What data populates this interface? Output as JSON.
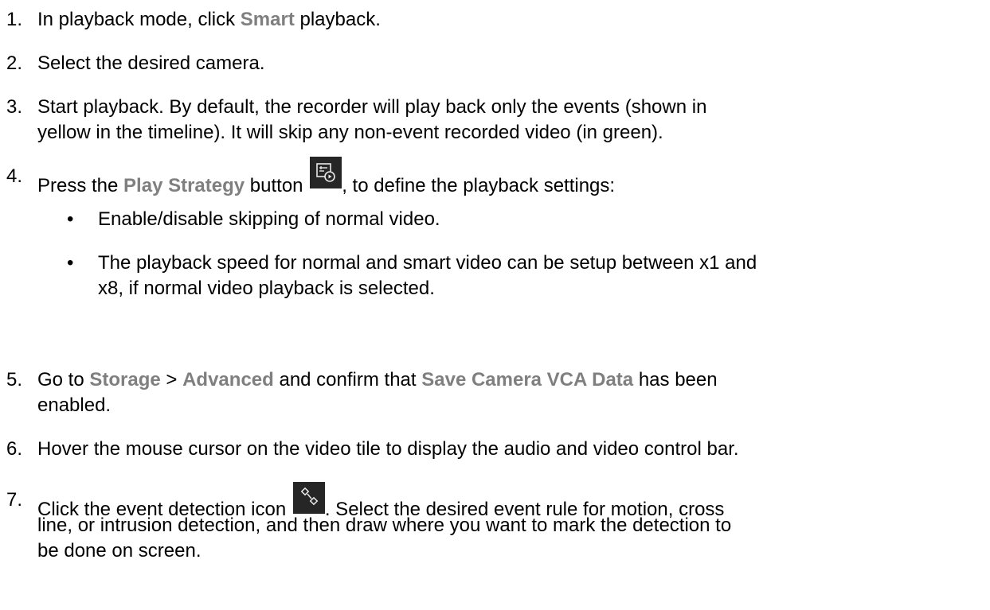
{
  "steps": [
    {
      "num": "1.",
      "pre": "In playback mode, click ",
      "hl": "Smart",
      "post": " playback."
    },
    {
      "num": "2.",
      "text": "Select the desired camera."
    },
    {
      "num": "3.",
      "line1": "Start playback. By default, the recorder will play back only the events (shown in",
      "line2": "yellow in the timeline). It will skip any non-event recorded video (in green)."
    },
    {
      "num": "4.",
      "pre": "Press the ",
      "hl": "Play Strategy",
      "mid": " button ",
      "icon": "play-strategy-icon",
      "post": ", to define the playback settings:"
    },
    {
      "num": "5.",
      "pre": "Go to ",
      "hl1": "Storage",
      "sep": " > ",
      "hl2": "Advanced",
      "mid": " and confirm that ",
      "hl3": "Save Camera VCA Data",
      "post": " has been",
      "line2": "enabled."
    },
    {
      "num": "6.",
      "text": "Hover the mouse cursor on the video tile to display the audio and video control bar."
    },
    {
      "num": "7.",
      "pre": "Click the event detection icon ",
      "icon": "event-detection-icon",
      "post": ". Select the desired event rule for motion, cross",
      "line2": "line, or intrusion detection, and then draw where you want to mark the detection to",
      "line3": "be done on screen."
    }
  ],
  "bullets": [
    {
      "bullet": "•",
      "text": "Enable/disable skipping of normal video."
    },
    {
      "bullet": "•",
      "line1": "The playback speed for normal and smart video can be setup between x1 and",
      "line2": "x8, if normal video playback is selected."
    }
  ]
}
